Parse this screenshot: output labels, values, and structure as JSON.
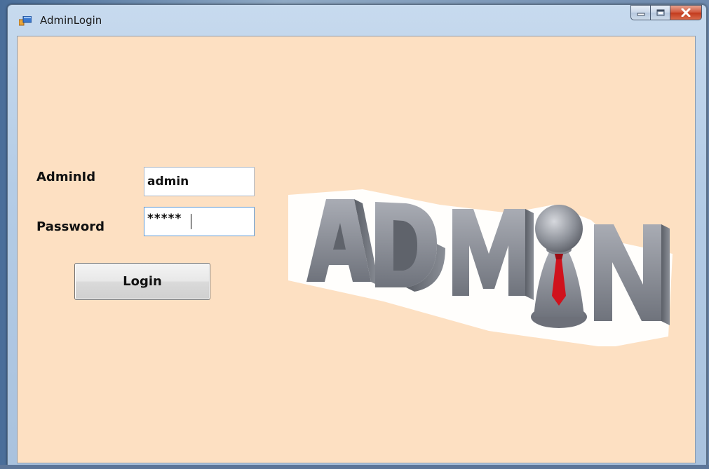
{
  "window": {
    "title": "AdminLogin",
    "icon": "form-app-icon",
    "caption": {
      "minimize": "minimize-icon",
      "maximize": "maximize-icon",
      "close": "close-icon"
    }
  },
  "form": {
    "background_color": "#fde0c2",
    "admin_id": {
      "label": "AdminId",
      "value": "admin"
    },
    "password": {
      "label": "Password",
      "value": "*****"
    },
    "login_button_label": "Login"
  },
  "banner": {
    "text": "ADMIN",
    "icon": "admin-pawn-with-tie-icon",
    "colors": {
      "letters": "#8a8d96",
      "tie": "#d0121c",
      "outline": "#ffffff"
    }
  }
}
